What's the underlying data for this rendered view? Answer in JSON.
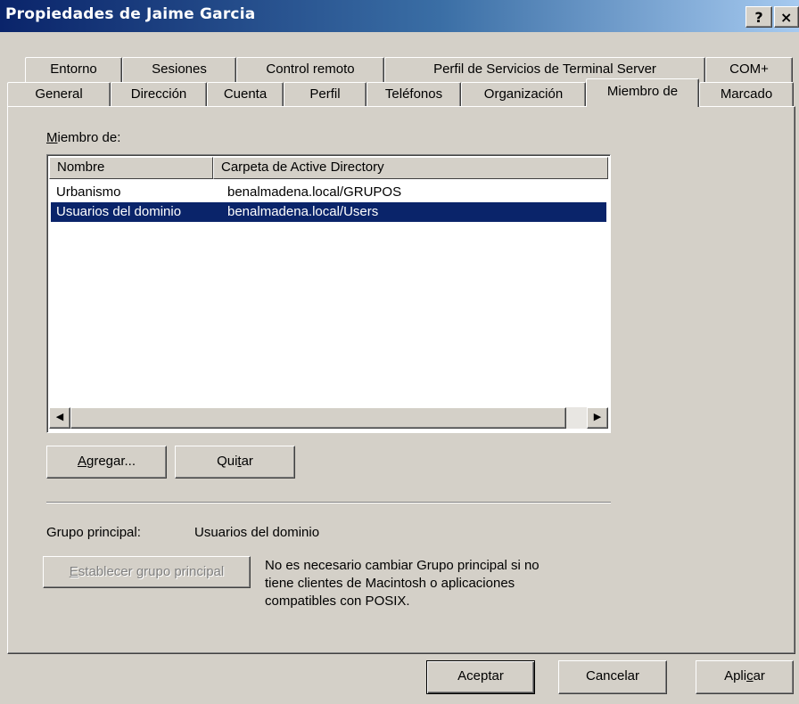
{
  "window": {
    "title": "Propiedades de Jaime Garcia",
    "help_glyph": "?",
    "close_glyph": "×"
  },
  "tabs": {
    "row1": [
      "Entorno",
      "Sesiones",
      "Control remoto",
      "Perfil de Servicios de Terminal Server",
      "COM+"
    ],
    "row2": [
      "General",
      "Dirección",
      "Cuenta",
      "Perfil",
      "Teléfonos",
      "Organización",
      "Miembro de",
      "Marcado"
    ],
    "active": "Miembro de"
  },
  "member_of": {
    "label_pre": "",
    "label_mnemonic": "M",
    "label_post": "iembro de:",
    "columns": [
      "Nombre",
      "Carpeta de Active Directory"
    ],
    "rows": [
      {
        "name": "Urbanismo",
        "folder": "benalmadena.local/GRUPOS",
        "selected": false
      },
      {
        "name": "Usuarios del dominio",
        "folder": "benalmadena.local/Users",
        "selected": true
      }
    ],
    "selection_color": "#0a246a"
  },
  "buttons": {
    "add": {
      "pre": "",
      "mnemonic": "A",
      "post": "gregar..."
    },
    "remove": {
      "pre": "Qui",
      "mnemonic": "t",
      "post": "ar"
    },
    "set_primary": {
      "pre": "",
      "mnemonic": "E",
      "post": "stablecer grupo principal"
    },
    "ok": "Aceptar",
    "cancel": "Cancelar",
    "apply": {
      "pre": "Apli",
      "mnemonic": "c",
      "post": "ar"
    }
  },
  "primary_group": {
    "label": "Grupo principal:",
    "value": "Usuarios del dominio",
    "note_lines": [
      "No es necesario cambiar Grupo principal si no",
      "tiene clientes de Macintosh o aplicaciones",
      "compatibles con POSIX."
    ]
  }
}
